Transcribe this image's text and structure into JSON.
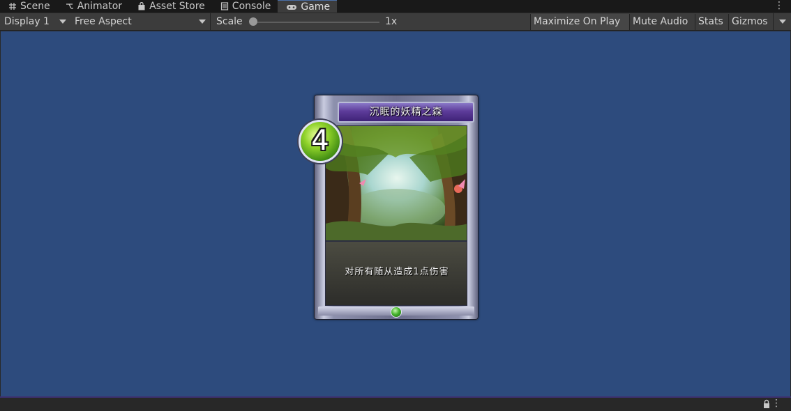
{
  "tabs": [
    {
      "label": "Scene",
      "icon": "grid-icon"
    },
    {
      "label": "Animator",
      "icon": "animator-icon"
    },
    {
      "label": "Asset Store",
      "icon": "bag-icon"
    },
    {
      "label": "Console",
      "icon": "console-icon"
    },
    {
      "label": "Game",
      "icon": "gamepad-icon"
    }
  ],
  "active_tab": "Game",
  "tab_menu": "⋮",
  "toolbar": {
    "display": "Display 1",
    "aspect": "Free Aspect",
    "scale_label": "Scale",
    "scale_value": "1x",
    "scale_fraction": 0.0,
    "maximize": "Maximize On Play",
    "mute": "Mute Audio",
    "stats": "Stats",
    "gizmos": "Gizmos"
  },
  "card": {
    "cost": "4",
    "name": "沉眠的妖精之森",
    "description": "对所有随从造成1点伤害"
  },
  "status": {
    "lock": "lock-icon",
    "menu": "⋮"
  },
  "colors": {
    "viewport_bg": "#2d4b7d",
    "title_purple": "#5d3c9a",
    "cost_green": "#8fd22a"
  }
}
